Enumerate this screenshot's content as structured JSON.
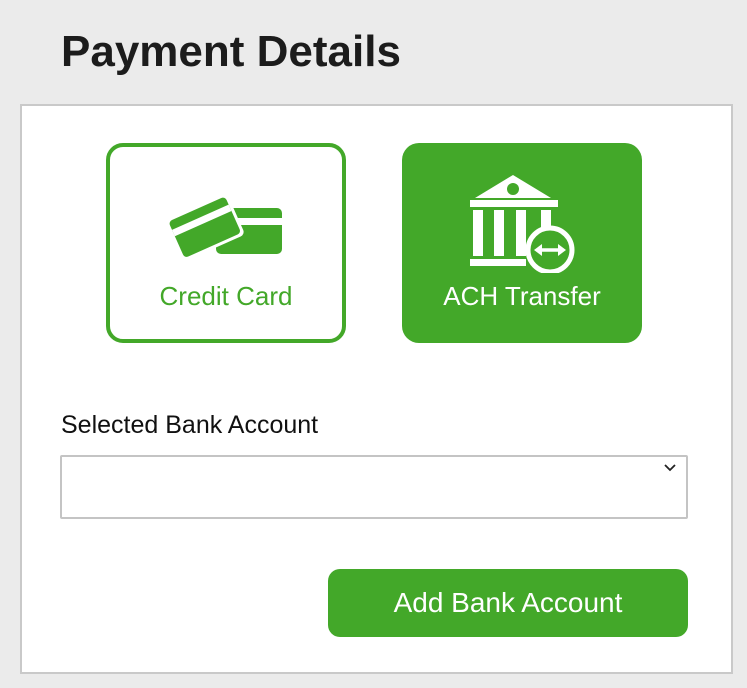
{
  "page": {
    "title": "Payment Details"
  },
  "payment_methods": [
    {
      "label": "Credit Card",
      "icon": "credit-cards-icon",
      "selected": false
    },
    {
      "label": "ACH Transfer",
      "icon": "bank-transfer-icon",
      "selected": true
    }
  ],
  "bank_account": {
    "label": "Selected Bank Account",
    "value": "",
    "icon": "chevron-down-icon"
  },
  "actions": {
    "add_bank_account": "Add Bank Account"
  },
  "colors": {
    "accent": "#43a829",
    "background": "#ebebeb",
    "panel": "#ffffff",
    "border": "#c9c9c9",
    "text": "#1c1c1c"
  }
}
